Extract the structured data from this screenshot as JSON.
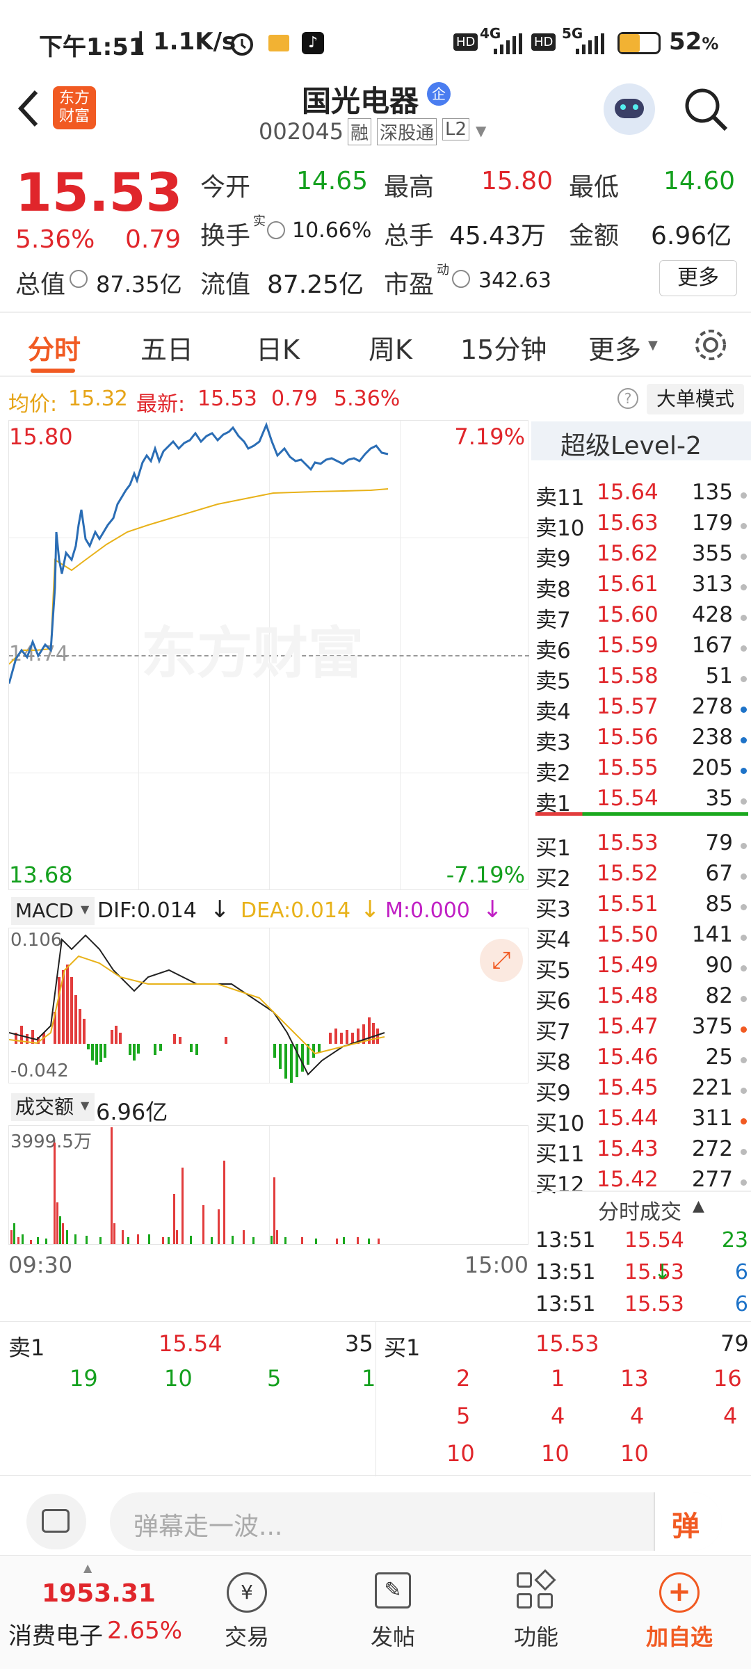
{
  "status": {
    "time": "下午1:51",
    "speed": "1.1K/s",
    "net1": "4G",
    "net2": "5G",
    "battery": "52",
    "battery_unit": "%",
    "hd": "HD"
  },
  "header": {
    "brand_line1": "东方",
    "brand_line2": "财富",
    "stock_name": "国光电器",
    "enterprise_badge": "企",
    "code": "002045",
    "tag_margin": "融",
    "tag_connect": "深股通",
    "tag_level": "L2"
  },
  "quote": {
    "price": "15.53",
    "pct": "5.36%",
    "chg": "0.79",
    "open_label": "今开",
    "open": "14.65",
    "high_label": "最高",
    "high": "15.80",
    "low_label": "最低",
    "low": "14.60",
    "turnover_label": "换手",
    "turnover_sup": "实",
    "turnover": "10.66%",
    "volume_label": "总手",
    "volume": "45.43万",
    "amount_label": "金额",
    "amount": "6.96亿",
    "mcap_label": "总值",
    "mcap": "87.35亿",
    "float_label": "流值",
    "float": "87.25亿",
    "pe_label": "市盈",
    "pe_sup": "动",
    "pe": "342.63",
    "more_btn": "更多"
  },
  "tabs": [
    "分时",
    "五日",
    "日K",
    "周K",
    "15分钟",
    "更多"
  ],
  "info_line": {
    "avg_label": "均价:",
    "avg": "15.32",
    "latest_label": "最新:",
    "latest": "15.53",
    "chg": "0.79",
    "pct": "5.36%",
    "mode_btn": "大单模式"
  },
  "chart": {
    "ymax": "15.80",
    "ymax_pct": "7.19%",
    "ymin": "13.68",
    "ymin_pct": "-7.19%",
    "prev_close": "14.74",
    "watermark": "东方财富",
    "time_start": "09:30",
    "time_end": "15:00"
  },
  "macd": {
    "selector": "MACD",
    "dif": "DIF:0.014",
    "dea": "DEA:0.014",
    "m": "M:0.000",
    "top": "0.106",
    "bottom": "-0.042"
  },
  "vol": {
    "selector": "成交额",
    "total": "6.96亿",
    "max": "3999.5万"
  },
  "orderbook": {
    "title": "超级Level-2",
    "asks": [
      {
        "label": "卖11",
        "price": "15.64",
        "qty": "135"
      },
      {
        "label": "卖10",
        "price": "15.63",
        "qty": "179"
      },
      {
        "label": "卖9",
        "price": "15.62",
        "qty": "355"
      },
      {
        "label": "卖8",
        "price": "15.61",
        "qty": "313"
      },
      {
        "label": "卖7",
        "price": "15.60",
        "qty": "428"
      },
      {
        "label": "卖6",
        "price": "15.59",
        "qty": "167"
      },
      {
        "label": "卖5",
        "price": "15.58",
        "qty": "51"
      },
      {
        "label": "卖4",
        "price": "15.57",
        "qty": "278"
      },
      {
        "label": "卖3",
        "price": "15.56",
        "qty": "238"
      },
      {
        "label": "卖2",
        "price": "15.55",
        "qty": "205"
      },
      {
        "label": "卖1",
        "price": "15.54",
        "qty": "35"
      }
    ],
    "bids": [
      {
        "label": "买1",
        "price": "15.53",
        "qty": "79"
      },
      {
        "label": "买2",
        "price": "15.52",
        "qty": "67"
      },
      {
        "label": "买3",
        "price": "15.51",
        "qty": "85"
      },
      {
        "label": "买4",
        "price": "15.50",
        "qty": "141"
      },
      {
        "label": "买5",
        "price": "15.49",
        "qty": "90"
      },
      {
        "label": "买6",
        "price": "15.48",
        "qty": "82"
      },
      {
        "label": "买7",
        "price": "15.47",
        "qty": "375"
      },
      {
        "label": "买8",
        "price": "15.46",
        "qty": "25"
      },
      {
        "label": "买9",
        "price": "15.45",
        "qty": "221"
      },
      {
        "label": "买10",
        "price": "15.44",
        "qty": "311"
      },
      {
        "label": "买11",
        "price": "15.43",
        "qty": "272"
      },
      {
        "label": "买12",
        "price": "15.42",
        "qty": "277"
      }
    ],
    "ticks_title": "分时成交",
    "ticks": [
      {
        "time": "13:51",
        "price": "15.54",
        "qty": "23"
      },
      {
        "time": "13:51",
        "price": "15.53",
        "qty": "6"
      },
      {
        "time": "13:51",
        "price": "15.53",
        "qty": "6"
      }
    ]
  },
  "queue": {
    "ask_label": "卖1",
    "ask_price": "15.54",
    "ask_qty": "35",
    "bid_label": "买1",
    "bid_price": "15.53",
    "bid_qty": "79",
    "ask_orders": [
      "19",
      "10",
      "5",
      "1"
    ],
    "bid_orders": [
      "2",
      "1",
      "13",
      "16",
      "5",
      "4",
      "4",
      "4",
      "10",
      "10",
      "10"
    ]
  },
  "comment": {
    "placeholder": "弹幕走一波...",
    "barrage_btn": "弹"
  },
  "bottom": {
    "index_value": "1953.31",
    "index_name": "消费电子",
    "index_pct": "2.65%",
    "trade": "交易",
    "post": "发帖",
    "func": "功能",
    "watch": "加自选"
  }
}
